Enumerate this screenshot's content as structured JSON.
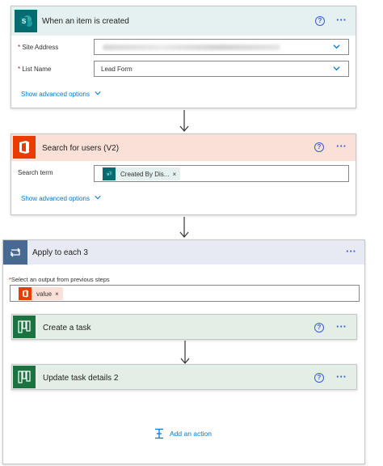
{
  "trigger": {
    "title": "When an item is created",
    "site_address_label": "Site Address",
    "list_name_label": "List Name",
    "list_name_value": "Lead Form",
    "advanced": "Show advanced options"
  },
  "search": {
    "title": "Search for users (V2)",
    "term_label": "Search term",
    "token": "Created By Dis...",
    "token_close": "×",
    "advanced": "Show advanced options"
  },
  "apply": {
    "title": "Apply to each 3",
    "select_label": "Select an output from previous steps",
    "token": "value",
    "token_close": "×"
  },
  "create_task": {
    "title": "Create a task"
  },
  "update_task": {
    "title": "Update task details 2"
  },
  "add_action": "Add an action",
  "common": {
    "help": "?",
    "more": "···",
    "required": "*"
  },
  "colors": {
    "trigger_header": "#e5f0f0",
    "search_header": "#fbe0d8",
    "apply_header": "#e7eaf2",
    "planner_header": "#e3efe6",
    "sharepoint": "#036c70",
    "office": "#eb3c00",
    "planner": "#1a7341",
    "apply_icon": "#486991",
    "link": "#0078d4"
  }
}
